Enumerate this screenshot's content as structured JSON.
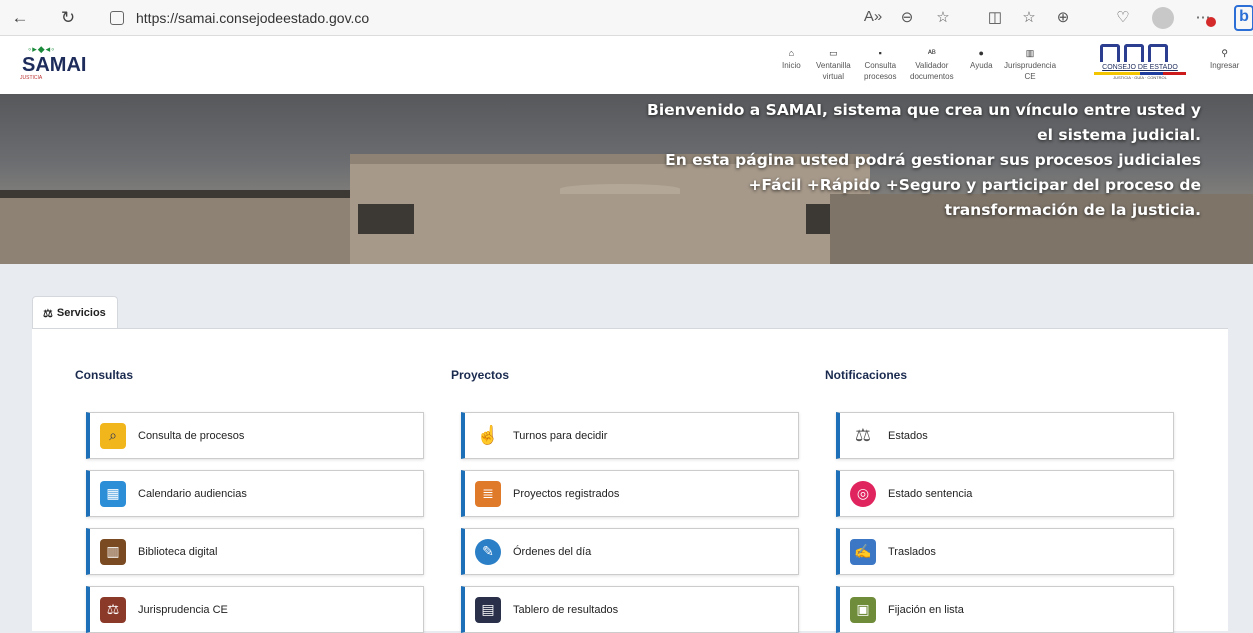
{
  "browser": {
    "url": "https://samai.consejodeestado.gov.co"
  },
  "header": {
    "logo_text": "SAMAI",
    "logo_sub": "JUSTICIA",
    "nav": [
      {
        "label": "Inicio",
        "label2": "",
        "icon": "home-icon"
      },
      {
        "label": "Ventanilla",
        "label2": "virtual",
        "icon": "window-icon"
      },
      {
        "label": "Consulta",
        "label2": "procesos",
        "icon": "folder-icon"
      },
      {
        "label": "Validador",
        "label2": "documentos",
        "icon": "validator-icon"
      },
      {
        "label": "Ayuda",
        "label2": "",
        "icon": "help-icon"
      },
      {
        "label": "Jurisprudencia",
        "label2": "CE",
        "icon": "books-icon"
      }
    ],
    "ce_logo_text": "CONSEJO DE ESTADO",
    "ce_logo_tag": "JUSTICIA · GUÍA · CONTROL",
    "login_label": "Ingresar"
  },
  "hero": {
    "lines": [
      "Bienvenido a SAMAI, sistema que crea un vínculo entre usted y",
      "el sistema judicial.",
      "En esta página usted podrá gestionar sus procesos judiciales",
      "+Fácil +Rápido +Seguro y participar del proceso de",
      "transformación de la justicia."
    ]
  },
  "services": {
    "tab_label": "Servicios",
    "columns": [
      {
        "title": "Consultas",
        "items": [
          {
            "label": "Consulta de procesos",
            "icon": "search-folder-icon",
            "color": "#f2b61d"
          },
          {
            "label": "Calendario audiencias",
            "icon": "calendar-icon",
            "color": "#2d8ed8"
          },
          {
            "label": "Biblioteca digital",
            "icon": "bookshelf-icon",
            "color": "#7a4a22"
          },
          {
            "label": "Jurisprudencia CE",
            "icon": "law-book-icon",
            "color": "#8b3a2a"
          }
        ]
      },
      {
        "title": "Proyectos",
        "items": [
          {
            "label": "Turnos para decidir",
            "icon": "hand-pointer-icon",
            "color": "#e04a3c"
          },
          {
            "label": "Proyectos registrados",
            "icon": "document-list-icon",
            "color": "#e07a2b"
          },
          {
            "label": "Órdenes del día",
            "icon": "checklist-icon",
            "color": "#2b7fc7"
          },
          {
            "label": "Tablero de resultados",
            "icon": "dashboard-icon",
            "color": "#2a2f4a"
          }
        ]
      },
      {
        "title": "Notificaciones",
        "items": [
          {
            "label": "Estados",
            "icon": "justice-scale-icon",
            "color": "#6d6d6d"
          },
          {
            "label": "Estado sentencia",
            "icon": "target-icon",
            "color": "#e0245e"
          },
          {
            "label": "Traslados",
            "icon": "transfer-document-icon",
            "color": "#3b77c4"
          },
          {
            "label": "Fijación en lista",
            "icon": "board-list-icon",
            "color": "#6f8c3a"
          }
        ]
      }
    ]
  }
}
